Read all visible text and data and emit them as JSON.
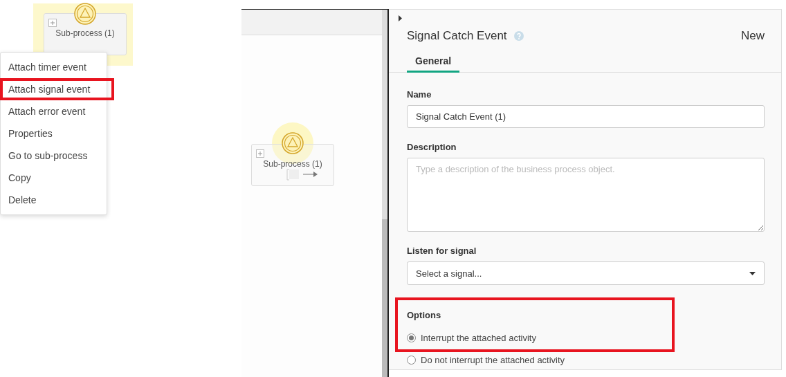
{
  "fragment": {
    "node": {
      "label": "Sub-process (1)",
      "selected": true
    },
    "context_menu": [
      {
        "label": "Attach timer event",
        "highlighted": false
      },
      {
        "label": "Attach signal event",
        "highlighted": true
      },
      {
        "label": "Attach error event",
        "highlighted": false
      },
      {
        "label": "Properties",
        "highlighted": false
      },
      {
        "label": "Go to sub-process",
        "highlighted": false
      },
      {
        "label": "Copy",
        "highlighted": false
      },
      {
        "label": "Delete",
        "highlighted": false
      }
    ]
  },
  "canvas": {
    "node": {
      "label": "Sub-process (1)",
      "selected": true
    }
  },
  "properties": {
    "title": "Signal Catch Event",
    "status": "New",
    "tabs": [
      {
        "label": "General",
        "selected": true
      }
    ],
    "fields": [
      {
        "kind": "text",
        "label": "Name",
        "value": "Signal Catch Event (1)"
      },
      {
        "kind": "textarea",
        "label": "Description",
        "placeholder": "Type a description of the business process object."
      },
      {
        "kind": "select",
        "label": "Listen for signal",
        "value": "Select a signal..."
      }
    ],
    "options": {
      "label": "Options",
      "highlighted": true,
      "choices": [
        {
          "label": "Interrupt the attached activity",
          "selected": true
        },
        {
          "label": "Do not interrupt the attached activity",
          "selected": false
        }
      ]
    }
  }
}
